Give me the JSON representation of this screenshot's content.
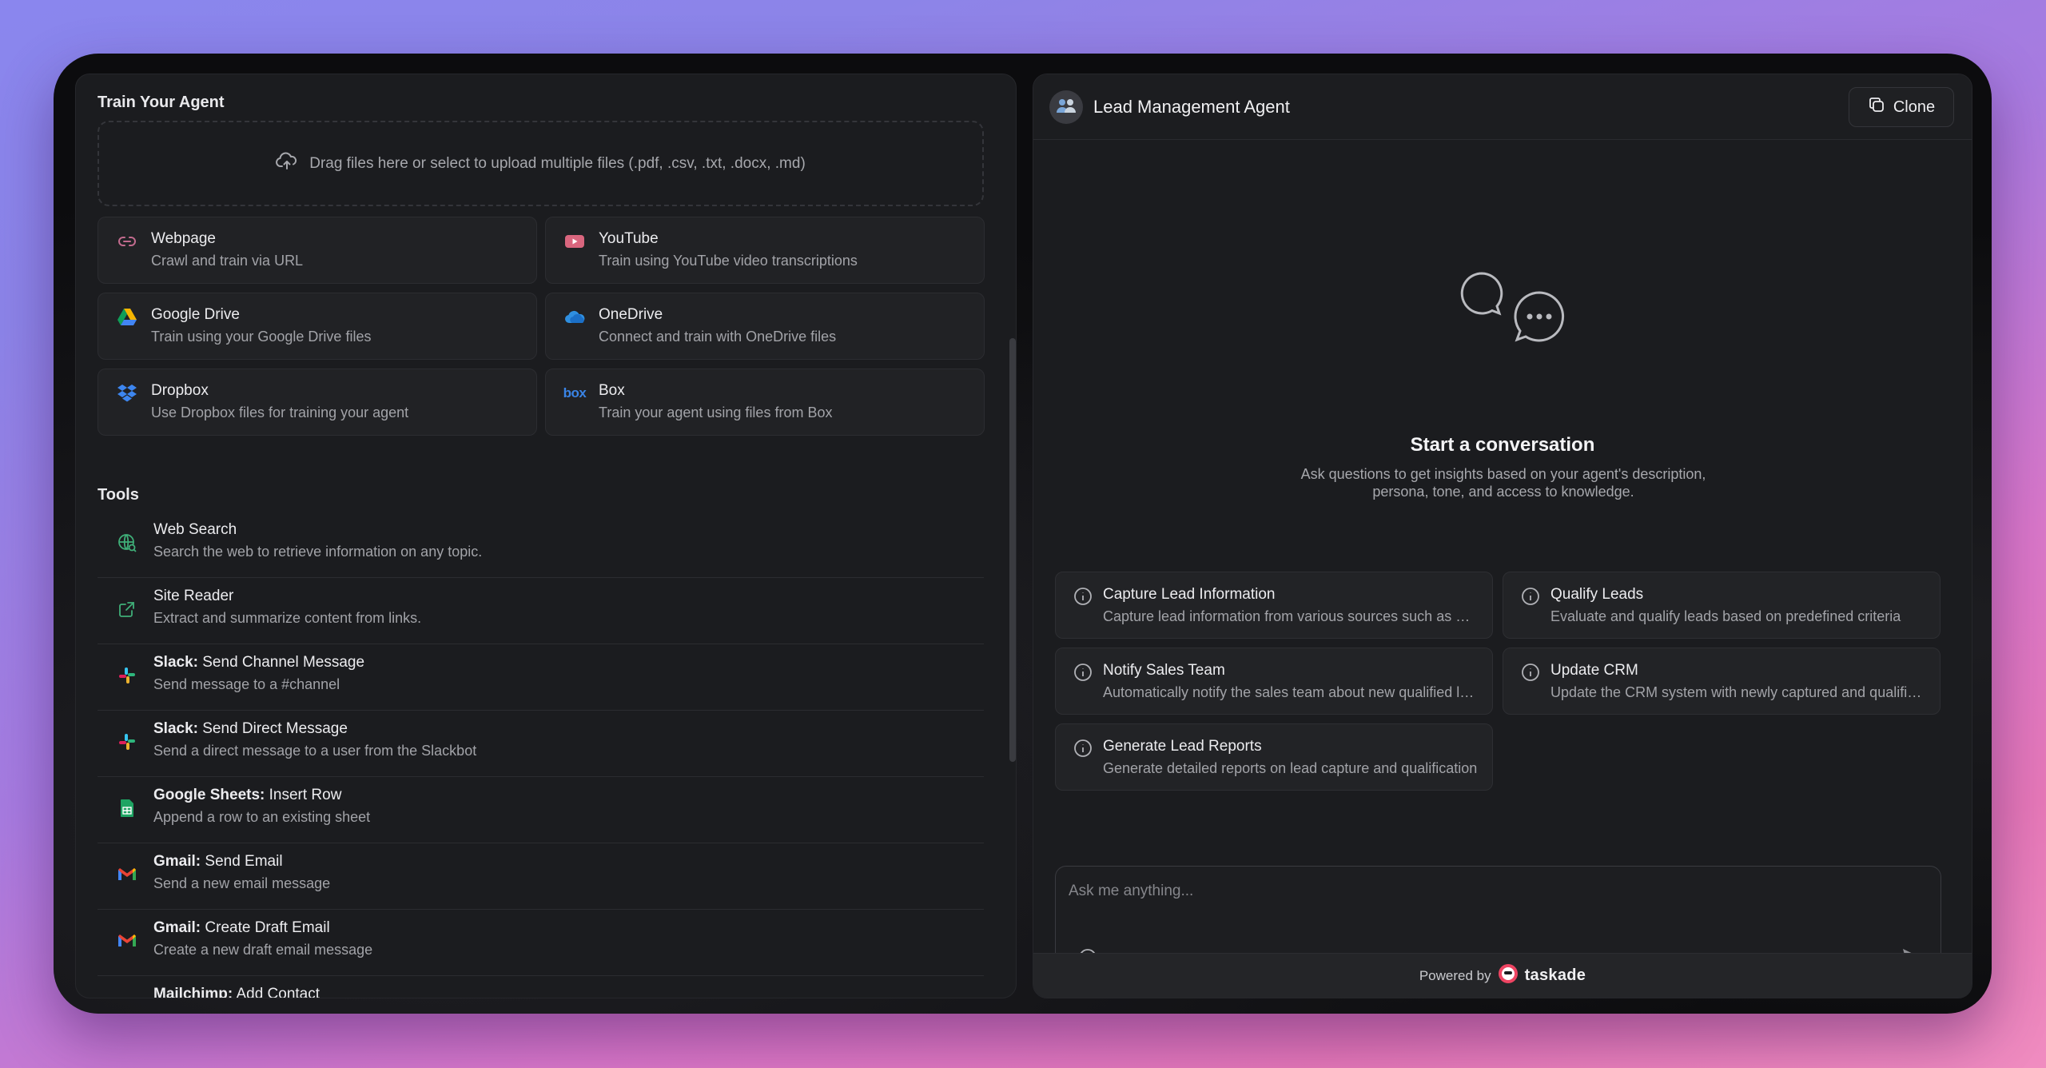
{
  "left": {
    "train_title": "Train Your Agent",
    "dropzone_text": "Drag files here or select to upload multiple files (.pdf, .csv, .txt, .docx, .md)",
    "sources": [
      {
        "title": "Webpage",
        "desc": "Crawl and train via URL",
        "icon": "link-icon"
      },
      {
        "title": "YouTube",
        "desc": "Train using YouTube video transcriptions",
        "icon": "youtube-icon"
      },
      {
        "title": "Google Drive",
        "desc": "Train using your Google Drive files",
        "icon": "google-drive-icon"
      },
      {
        "title": "OneDrive",
        "desc": "Connect and train with OneDrive files",
        "icon": "onedrive-icon"
      },
      {
        "title": "Dropbox",
        "desc": "Use Dropbox files for training your agent",
        "icon": "dropbox-icon"
      },
      {
        "title": "Box",
        "desc": "Train your agent using files from Box",
        "icon": "box-icon"
      }
    ],
    "tools_title": "Tools",
    "tools": [
      {
        "app": "",
        "action": "Web Search",
        "desc": "Search the web to retrieve information on any topic.",
        "icon": "globe-search-icon"
      },
      {
        "app": "",
        "action": "Site Reader",
        "desc": "Extract and summarize content from links.",
        "icon": "external-link-icon"
      },
      {
        "app": "Slack:",
        "action": " Send Channel Message",
        "desc": "Send message to a #channel",
        "icon": "slack-icon"
      },
      {
        "app": "Slack:",
        "action": " Send Direct Message",
        "desc": "Send a direct message to a user from the Slackbot",
        "icon": "slack-icon"
      },
      {
        "app": "Google Sheets:",
        "action": " Insert Row",
        "desc": "Append a row to an existing sheet",
        "icon": "google-sheets-icon"
      },
      {
        "app": "Gmail:",
        "action": " Send Email",
        "desc": "Send a new email message",
        "icon": "gmail-icon"
      },
      {
        "app": "Gmail:",
        "action": " Create Draft Email",
        "desc": "Create a new draft email message",
        "icon": "gmail-icon"
      },
      {
        "app": "Mailchimp:",
        "action": " Add Contact",
        "desc": "",
        "icon": "mailchimp-icon"
      }
    ]
  },
  "right": {
    "agent_name": "Lead Management Agent",
    "clone_label": "Clone",
    "empty_title": "Start a conversation",
    "empty_subtitle": "Ask questions to get insights based on your agent's description, persona, tone, and access to knowledge.",
    "prompts": [
      {
        "title": "Capture Lead Information",
        "desc": "Capture lead information from various sources such as website forms"
      },
      {
        "title": "Qualify Leads",
        "desc": "Evaluate and qualify leads based on predefined criteria"
      },
      {
        "title": "Notify Sales Team",
        "desc": "Automatically notify the sales team about new qualified leads"
      },
      {
        "title": "Update CRM",
        "desc": "Update the CRM system with newly captured and qualified leads"
      },
      {
        "title": "Generate Lead Reports",
        "desc": "Generate detailed reports on lead capture and qualification"
      }
    ],
    "input_placeholder": "Ask me anything...",
    "footer_powered": "Powered by",
    "footer_brand": "taskade"
  }
}
